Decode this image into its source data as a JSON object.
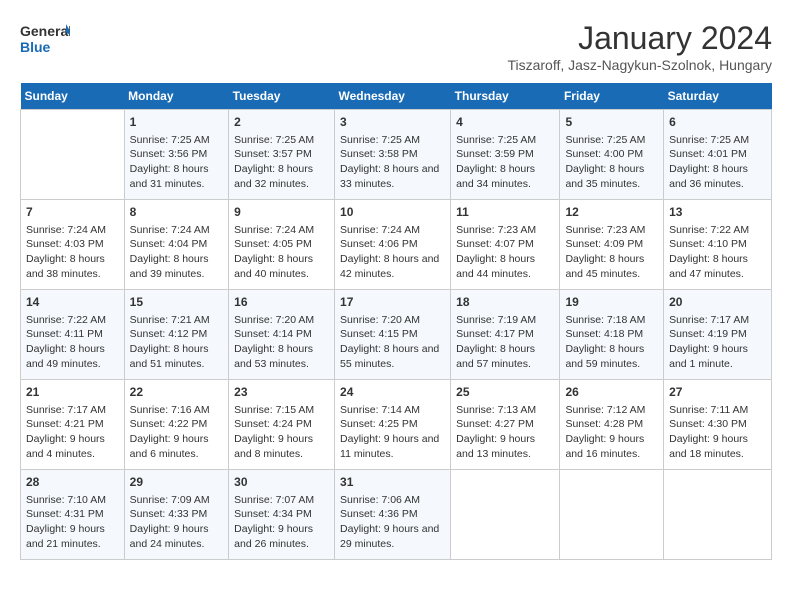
{
  "header": {
    "logo_line1": "General",
    "logo_line2": "Blue",
    "month": "January 2024",
    "location": "Tiszaroff, Jasz-Nagykun-Szolnok, Hungary"
  },
  "weekdays": [
    "Sunday",
    "Monday",
    "Tuesday",
    "Wednesday",
    "Thursday",
    "Friday",
    "Saturday"
  ],
  "weeks": [
    [
      {
        "day": "",
        "sunrise": "",
        "sunset": "",
        "daylight": ""
      },
      {
        "day": "1",
        "sunrise": "Sunrise: 7:25 AM",
        "sunset": "Sunset: 3:56 PM",
        "daylight": "Daylight: 8 hours and 31 minutes."
      },
      {
        "day": "2",
        "sunrise": "Sunrise: 7:25 AM",
        "sunset": "Sunset: 3:57 PM",
        "daylight": "Daylight: 8 hours and 32 minutes."
      },
      {
        "day": "3",
        "sunrise": "Sunrise: 7:25 AM",
        "sunset": "Sunset: 3:58 PM",
        "daylight": "Daylight: 8 hours and 33 minutes."
      },
      {
        "day": "4",
        "sunrise": "Sunrise: 7:25 AM",
        "sunset": "Sunset: 3:59 PM",
        "daylight": "Daylight: 8 hours and 34 minutes."
      },
      {
        "day": "5",
        "sunrise": "Sunrise: 7:25 AM",
        "sunset": "Sunset: 4:00 PM",
        "daylight": "Daylight: 8 hours and 35 minutes."
      },
      {
        "day": "6",
        "sunrise": "Sunrise: 7:25 AM",
        "sunset": "Sunset: 4:01 PM",
        "daylight": "Daylight: 8 hours and 36 minutes."
      }
    ],
    [
      {
        "day": "7",
        "sunrise": "Sunrise: 7:24 AM",
        "sunset": "Sunset: 4:03 PM",
        "daylight": "Daylight: 8 hours and 38 minutes."
      },
      {
        "day": "8",
        "sunrise": "Sunrise: 7:24 AM",
        "sunset": "Sunset: 4:04 PM",
        "daylight": "Daylight: 8 hours and 39 minutes."
      },
      {
        "day": "9",
        "sunrise": "Sunrise: 7:24 AM",
        "sunset": "Sunset: 4:05 PM",
        "daylight": "Daylight: 8 hours and 40 minutes."
      },
      {
        "day": "10",
        "sunrise": "Sunrise: 7:24 AM",
        "sunset": "Sunset: 4:06 PM",
        "daylight": "Daylight: 8 hours and 42 minutes."
      },
      {
        "day": "11",
        "sunrise": "Sunrise: 7:23 AM",
        "sunset": "Sunset: 4:07 PM",
        "daylight": "Daylight: 8 hours and 44 minutes."
      },
      {
        "day": "12",
        "sunrise": "Sunrise: 7:23 AM",
        "sunset": "Sunset: 4:09 PM",
        "daylight": "Daylight: 8 hours and 45 minutes."
      },
      {
        "day": "13",
        "sunrise": "Sunrise: 7:22 AM",
        "sunset": "Sunset: 4:10 PM",
        "daylight": "Daylight: 8 hours and 47 minutes."
      }
    ],
    [
      {
        "day": "14",
        "sunrise": "Sunrise: 7:22 AM",
        "sunset": "Sunset: 4:11 PM",
        "daylight": "Daylight: 8 hours and 49 minutes."
      },
      {
        "day": "15",
        "sunrise": "Sunrise: 7:21 AM",
        "sunset": "Sunset: 4:12 PM",
        "daylight": "Daylight: 8 hours and 51 minutes."
      },
      {
        "day": "16",
        "sunrise": "Sunrise: 7:20 AM",
        "sunset": "Sunset: 4:14 PM",
        "daylight": "Daylight: 8 hours and 53 minutes."
      },
      {
        "day": "17",
        "sunrise": "Sunrise: 7:20 AM",
        "sunset": "Sunset: 4:15 PM",
        "daylight": "Daylight: 8 hours and 55 minutes."
      },
      {
        "day": "18",
        "sunrise": "Sunrise: 7:19 AM",
        "sunset": "Sunset: 4:17 PM",
        "daylight": "Daylight: 8 hours and 57 minutes."
      },
      {
        "day": "19",
        "sunrise": "Sunrise: 7:18 AM",
        "sunset": "Sunset: 4:18 PM",
        "daylight": "Daylight: 8 hours and 59 minutes."
      },
      {
        "day": "20",
        "sunrise": "Sunrise: 7:17 AM",
        "sunset": "Sunset: 4:19 PM",
        "daylight": "Daylight: 9 hours and 1 minute."
      }
    ],
    [
      {
        "day": "21",
        "sunrise": "Sunrise: 7:17 AM",
        "sunset": "Sunset: 4:21 PM",
        "daylight": "Daylight: 9 hours and 4 minutes."
      },
      {
        "day": "22",
        "sunrise": "Sunrise: 7:16 AM",
        "sunset": "Sunset: 4:22 PM",
        "daylight": "Daylight: 9 hours and 6 minutes."
      },
      {
        "day": "23",
        "sunrise": "Sunrise: 7:15 AM",
        "sunset": "Sunset: 4:24 PM",
        "daylight": "Daylight: 9 hours and 8 minutes."
      },
      {
        "day": "24",
        "sunrise": "Sunrise: 7:14 AM",
        "sunset": "Sunset: 4:25 PM",
        "daylight": "Daylight: 9 hours and 11 minutes."
      },
      {
        "day": "25",
        "sunrise": "Sunrise: 7:13 AM",
        "sunset": "Sunset: 4:27 PM",
        "daylight": "Daylight: 9 hours and 13 minutes."
      },
      {
        "day": "26",
        "sunrise": "Sunrise: 7:12 AM",
        "sunset": "Sunset: 4:28 PM",
        "daylight": "Daylight: 9 hours and 16 minutes."
      },
      {
        "day": "27",
        "sunrise": "Sunrise: 7:11 AM",
        "sunset": "Sunset: 4:30 PM",
        "daylight": "Daylight: 9 hours and 18 minutes."
      }
    ],
    [
      {
        "day": "28",
        "sunrise": "Sunrise: 7:10 AM",
        "sunset": "Sunset: 4:31 PM",
        "daylight": "Daylight: 9 hours and 21 minutes."
      },
      {
        "day": "29",
        "sunrise": "Sunrise: 7:09 AM",
        "sunset": "Sunset: 4:33 PM",
        "daylight": "Daylight: 9 hours and 24 minutes."
      },
      {
        "day": "30",
        "sunrise": "Sunrise: 7:07 AM",
        "sunset": "Sunset: 4:34 PM",
        "daylight": "Daylight: 9 hours and 26 minutes."
      },
      {
        "day": "31",
        "sunrise": "Sunrise: 7:06 AM",
        "sunset": "Sunset: 4:36 PM",
        "daylight": "Daylight: 9 hours and 29 minutes."
      },
      {
        "day": "",
        "sunrise": "",
        "sunset": "",
        "daylight": ""
      },
      {
        "day": "",
        "sunrise": "",
        "sunset": "",
        "daylight": ""
      },
      {
        "day": "",
        "sunrise": "",
        "sunset": "",
        "daylight": ""
      }
    ]
  ]
}
